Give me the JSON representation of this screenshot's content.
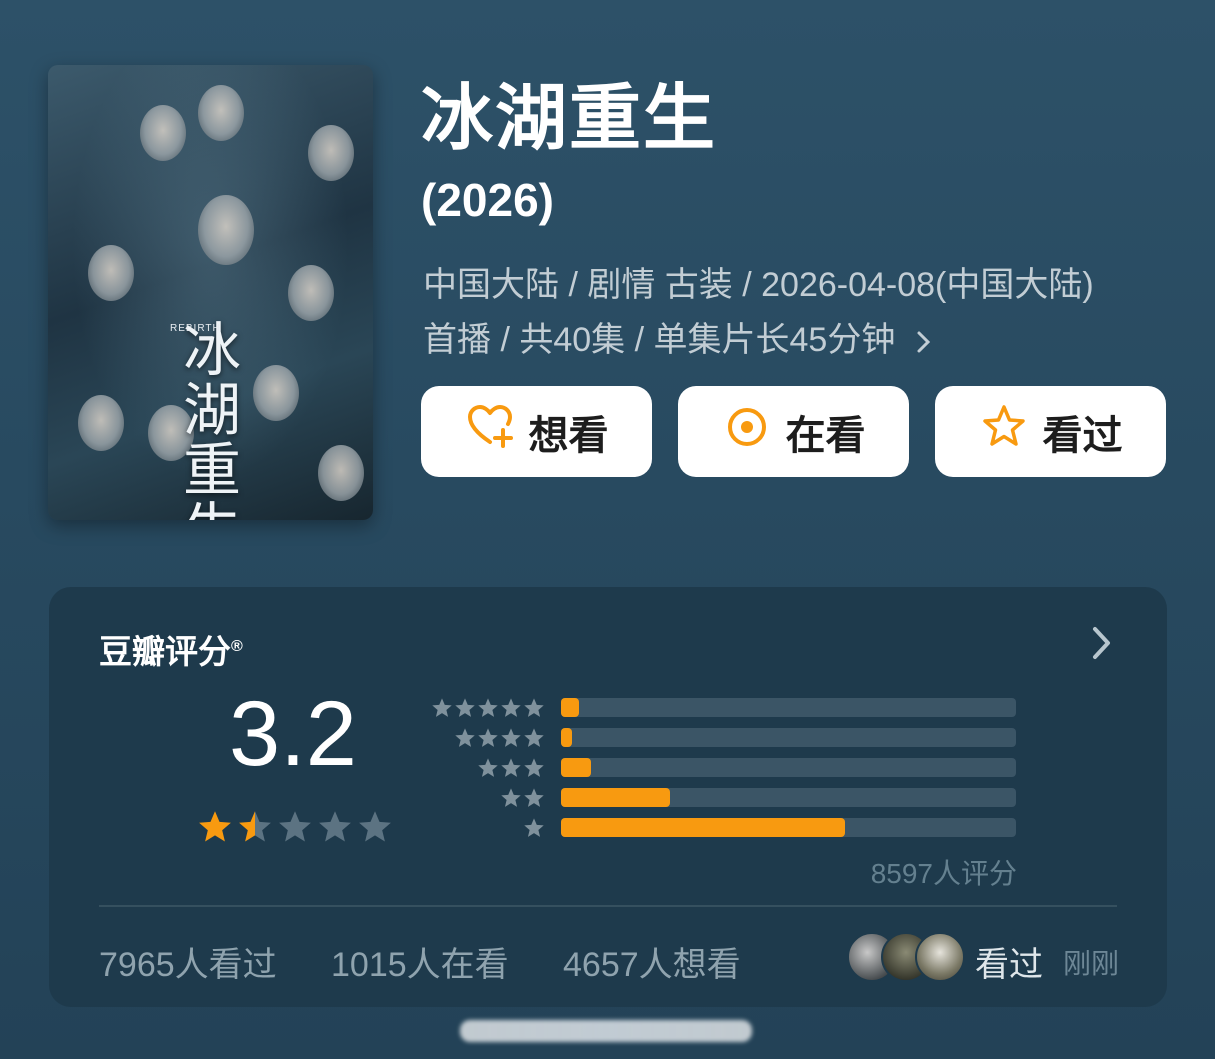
{
  "movie": {
    "title": "冰湖重生",
    "year": "(2026)",
    "meta_line1": "中国大陆 / 剧情 古装 / 2026-04-08(中国大陆)",
    "meta_line2": "首播 / 共40集 / 单集片长45分钟",
    "poster": {
      "calligraphy": "冰湖重生",
      "subtitle_en": "REBIRTH"
    }
  },
  "actions": {
    "want": "想看",
    "watching": "在看",
    "watched": "看过"
  },
  "rating_card": {
    "title": "豆瓣评分",
    "registered": "®",
    "score": "3.2",
    "score_stars": 1.5,
    "distribution": [
      {
        "stars": 5,
        "fraction": 0.04
      },
      {
        "stars": 4,
        "fraction": 0.025
      },
      {
        "stars": 3,
        "fraction": 0.065
      },
      {
        "stars": 2,
        "fraction": 0.24
      },
      {
        "stars": 1,
        "fraction": 0.625
      }
    ],
    "ratings_count": "8597人评分",
    "stats": {
      "watched": "7965人看过",
      "watching": "1015人在看",
      "want": "4657人想看"
    },
    "friend_activity": {
      "label": "看过",
      "time": "刚刚"
    }
  },
  "colors": {
    "accent": "#f89a10",
    "bar_bg": "#3b5566",
    "card_bg": "#1e3a4c"
  }
}
